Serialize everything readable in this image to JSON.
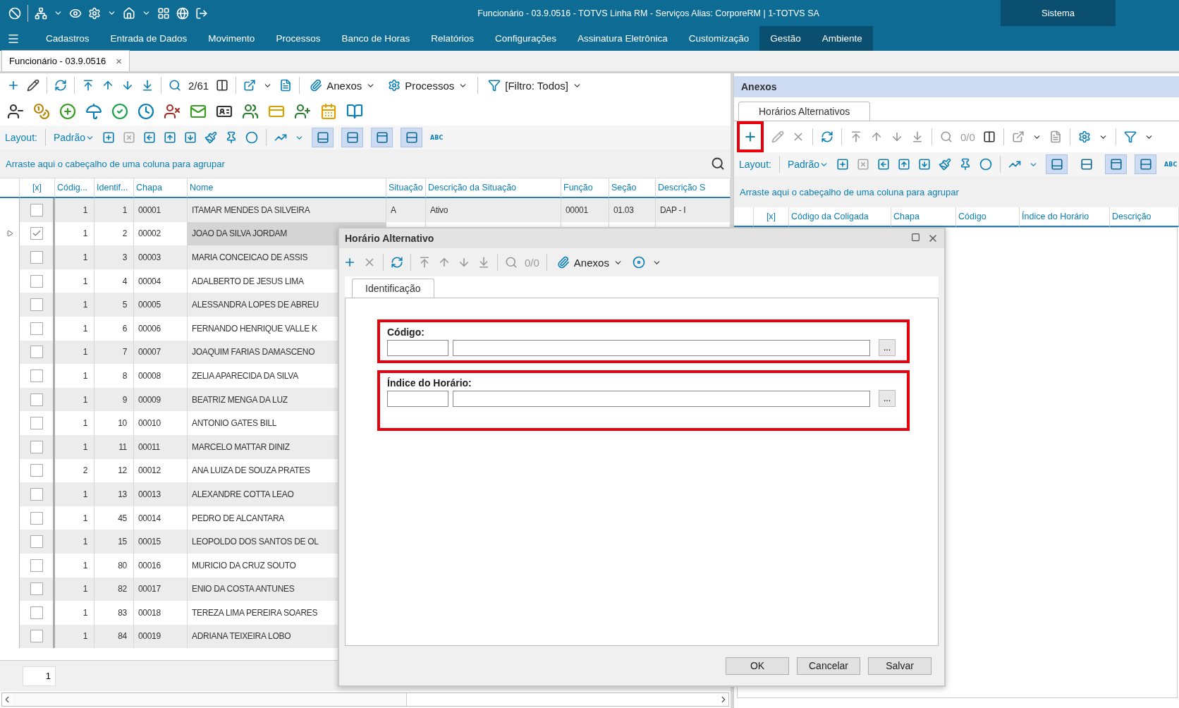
{
  "title_bar": {
    "title": "Funcionário - 03.9.0516 - TOTVS Linha RM - Serviços  Alias: CorporeRM | 1-TOTVS SA",
    "context_label": "Sistema"
  },
  "menu": [
    {
      "label": "Cadastros",
      "contextual": false
    },
    {
      "label": "Entrada de Dados",
      "contextual": false
    },
    {
      "label": "Movimento",
      "contextual": false
    },
    {
      "label": "Processos",
      "contextual": false
    },
    {
      "label": "Banco de Horas",
      "contextual": false
    },
    {
      "label": "Relatórios",
      "contextual": false
    },
    {
      "label": "Configurações",
      "contextual": false
    },
    {
      "label": "Assinatura Eletrônica",
      "contextual": false
    },
    {
      "label": "Customização",
      "contextual": false
    },
    {
      "label": "Gestão",
      "contextual": true
    },
    {
      "label": "Ambiente",
      "contextual": true
    }
  ],
  "doc_tab": {
    "label": "Funcionário - 03.9.0516",
    "close": "×"
  },
  "main": {
    "counter": "2/61",
    "anexos": "Anexos",
    "processos": "Processos",
    "filter": "[Filtro: Todos]",
    "layout": {
      "label": "Layout:",
      "preset": "Padrão",
      "abc": "ABC",
      "toggles": [
        {
          "selected": true
        },
        {
          "selected": true
        },
        {
          "selected": true
        },
        {
          "selected": true
        }
      ]
    },
    "group_hint": "Arraste aqui o cabeçalho de uma coluna para agrupar",
    "check_header": "[x]",
    "columns": [
      "Códig...",
      "Identif...",
      "Chapa",
      "Nome",
      "Situação",
      "Descrição da Situação",
      "Função",
      "Seção",
      "Descrição S"
    ],
    "rows": [
      {
        "checked": false,
        "current": false,
        "cells": [
          "1",
          "1",
          "00001",
          "ITAMAR MENDES DA SILVEIRA",
          "A",
          "Ativo",
          "00001",
          "01.03",
          "DAP - I"
        ]
      },
      {
        "checked": true,
        "current": true,
        "cells": [
          "1",
          "2",
          "00002",
          "JOAO DA SILVA JORDAM"
        ]
      },
      {
        "checked": false,
        "current": false,
        "cells": [
          "1",
          "3",
          "00003",
          "MARIA CONCEICAO DE ASSIS"
        ]
      },
      {
        "checked": false,
        "current": false,
        "cells": [
          "1",
          "4",
          "00004",
          "ADALBERTO DE JESUS LIMA"
        ]
      },
      {
        "checked": false,
        "current": false,
        "cells": [
          "1",
          "5",
          "00005",
          "ALESSANDRA LOPES DE ABREU"
        ]
      },
      {
        "checked": false,
        "current": false,
        "cells": [
          "1",
          "6",
          "00006",
          "FERNANDO HENRIQUE VALLE K"
        ]
      },
      {
        "checked": false,
        "current": false,
        "cells": [
          "1",
          "7",
          "00007",
          "JOAQUIM FARIAS DAMASCENO"
        ]
      },
      {
        "checked": false,
        "current": false,
        "cells": [
          "1",
          "8",
          "00008",
          "ZELIA APARECIDA DA SILVA"
        ]
      },
      {
        "checked": false,
        "current": false,
        "cells": [
          "1",
          "9",
          "00009",
          "BEATRIZ MENGA DA LUZ"
        ]
      },
      {
        "checked": false,
        "current": false,
        "cells": [
          "1",
          "10",
          "00010",
          "ANTONIO GATES BILL"
        ]
      },
      {
        "checked": false,
        "current": false,
        "cells": [
          "1",
          "11",
          "00011",
          "MARCELO MATTAR DINIZ"
        ]
      },
      {
        "checked": false,
        "current": false,
        "cells": [
          "2",
          "12",
          "00012",
          "ANA LUIZA  DE SOUZA PRATES"
        ]
      },
      {
        "checked": false,
        "current": false,
        "cells": [
          "1",
          "13",
          "00013",
          "ALEXANDRE COTTA LEAO"
        ]
      },
      {
        "checked": false,
        "current": false,
        "cells": [
          "1",
          "45",
          "00014",
          "PEDRO DE ALCANTARA"
        ]
      },
      {
        "checked": false,
        "current": false,
        "cells": [
          "1",
          "15",
          "00015",
          "LEOPOLDO DOS SANTOS DE OL"
        ]
      },
      {
        "checked": false,
        "current": false,
        "cells": [
          "1",
          "80",
          "00016",
          "MURICIO DA CRUZ SOUTO"
        ]
      },
      {
        "checked": false,
        "current": false,
        "cells": [
          "1",
          "82",
          "00017",
          "ENIO DA COSTA ANTUNES"
        ]
      },
      {
        "checked": false,
        "current": false,
        "cells": [
          "1",
          "83",
          "00018",
          "TEREZA LIMA PEREIRA SOARES"
        ]
      },
      {
        "checked": false,
        "current": false,
        "cells": [
          "1",
          "84",
          "00019",
          "ADRIANA TEIXEIRA LOBO"
        ]
      }
    ],
    "footer_count": "1"
  },
  "side": {
    "title": "Anexos",
    "tab": "Horários Alternativos",
    "add_highlighted": true,
    "counter": "0/0",
    "layout": {
      "label": "Layout:",
      "preset": "Padrão",
      "abc": "ABC",
      "toggles": [
        {
          "selected": true
        },
        {
          "selected": false
        },
        {
          "selected": true
        },
        {
          "selected": true
        }
      ]
    },
    "group_hint": "Arraste aqui o cabeçalho de uma coluna para agrupar",
    "check_header": "[x]",
    "columns": [
      "Código da Coligada",
      "Chapa",
      "Código",
      "Índice do Horário",
      "Descrição"
    ]
  },
  "dialog": {
    "title": "Horário Alternativo",
    "counter": "0/0",
    "anexos": "Anexos",
    "tab": "Identificação",
    "fields": [
      {
        "label": "Código:",
        "lookup": "...",
        "highlighted": true
      },
      {
        "label": "Índice do Horário:",
        "lookup": "...",
        "highlighted": true
      }
    ],
    "buttons": [
      "OK",
      "Cancelar",
      "Salvar"
    ]
  }
}
